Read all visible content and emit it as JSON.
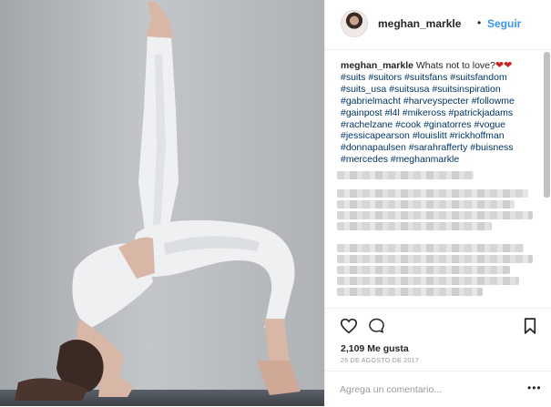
{
  "header": {
    "username": "meghan_markle",
    "separator": "•",
    "follow_label": "Seguir"
  },
  "caption": {
    "username": "meghan_markle",
    "text": "Whats not to love?",
    "hearts": "❤❤",
    "hashtags": [
      "#suits",
      "#suitors",
      "#suitsfans",
      "#suitsfandom",
      "#suits_usa",
      "#suitsusa",
      "#suitsinspiration",
      "#gabrielmacht",
      "#harveyspecter",
      "#followme",
      "#gainpost",
      "#l4l",
      "#mikeross",
      "#patrickjadams",
      "#rachelzane",
      "#cook",
      "#ginatorres",
      "#vogue",
      "#jessicapearson",
      "#louislitt",
      "#rickhoffman",
      "#donnapaulsen",
      "#sarahrafferty",
      "#buisness",
      "#mercedes",
      "#meghanmarkle"
    ]
  },
  "actions": {
    "likes": "2,109 Me gusta",
    "date": "26 DE AGOSTO DE 2017",
    "icons": [
      "heart-icon",
      "comment-icon",
      "bookmark-icon"
    ]
  },
  "comment": {
    "placeholder": "Agrega un comentario...",
    "more": "•••"
  },
  "colors": {
    "link": "#3897f0",
    "hashtag": "#003569",
    "text": "#262626",
    "muted": "#999999"
  }
}
